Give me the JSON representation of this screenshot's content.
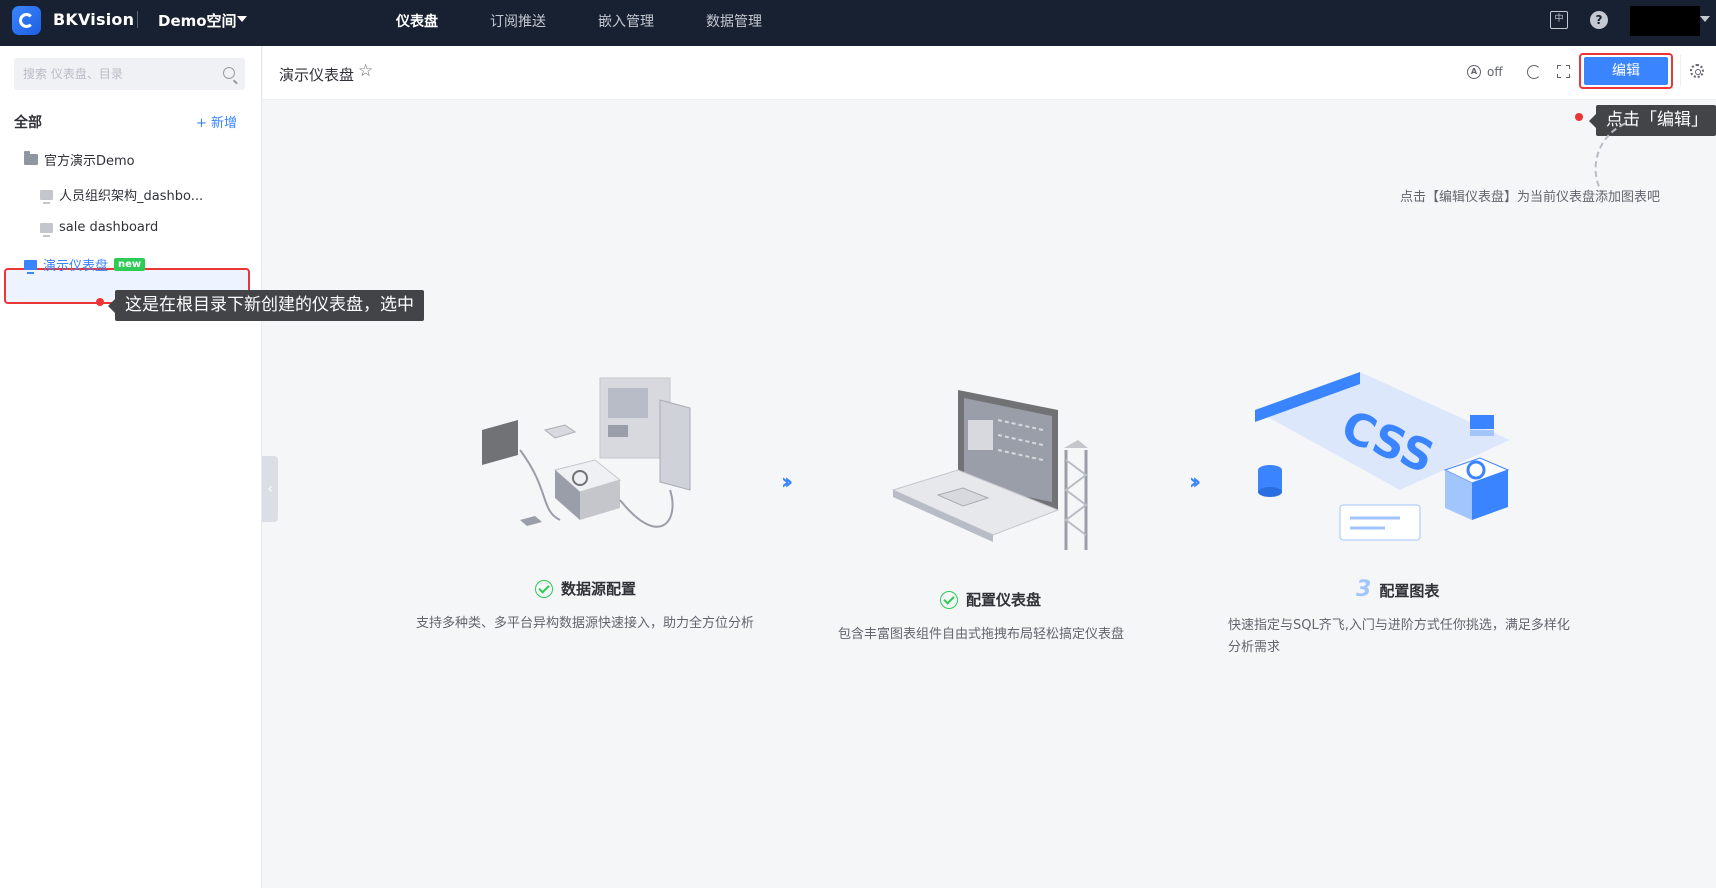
{
  "topbar": {
    "app_name": "BKVision",
    "space_name": "Demo空间",
    "nav": [
      "仪表盘",
      "订阅推送",
      "嵌入管理",
      "数据管理"
    ],
    "active_nav": "仪表盘",
    "lang_icon": "中"
  },
  "sidebar": {
    "search_placeholder": "搜索 仪表盘、目录",
    "all_label": "全部",
    "add_label": "+ 新增",
    "folder": "官方演示Demo",
    "items": [
      "人员组织架构_dashbo...",
      "sale dashboard"
    ],
    "selected_item": "演示仪表盘",
    "selected_badge": "new",
    "tooltip": "这是在根目录下新创建的仪表盘，选中"
  },
  "header": {
    "title": "演示仪表盘",
    "auto_refresh": "off",
    "edit_label": "编辑",
    "edit_tooltip": "点击「编辑」"
  },
  "main": {
    "hint": "点击【编辑仪表盘】为当前仪表盘添加图表吧",
    "steps": [
      {
        "title": "数据源配置",
        "desc": "支持多种类、多平台异构数据源快速接入，助力全方位分析",
        "state": "done"
      },
      {
        "title": "配置仪表盘",
        "desc": "包含丰富图表组件自由式拖拽布局轻松搞定仪表盘",
        "state": "done"
      },
      {
        "title": "配置图表",
        "desc": "快速指定与SQL齐飞,入门与进阶方式任你挑选，满足多样化分析需求",
        "state": "3"
      }
    ]
  },
  "colors": {
    "topbar": "#182132",
    "primary": "#3a84ff",
    "highlight": "#ea3636",
    "success": "#2dcb56"
  }
}
